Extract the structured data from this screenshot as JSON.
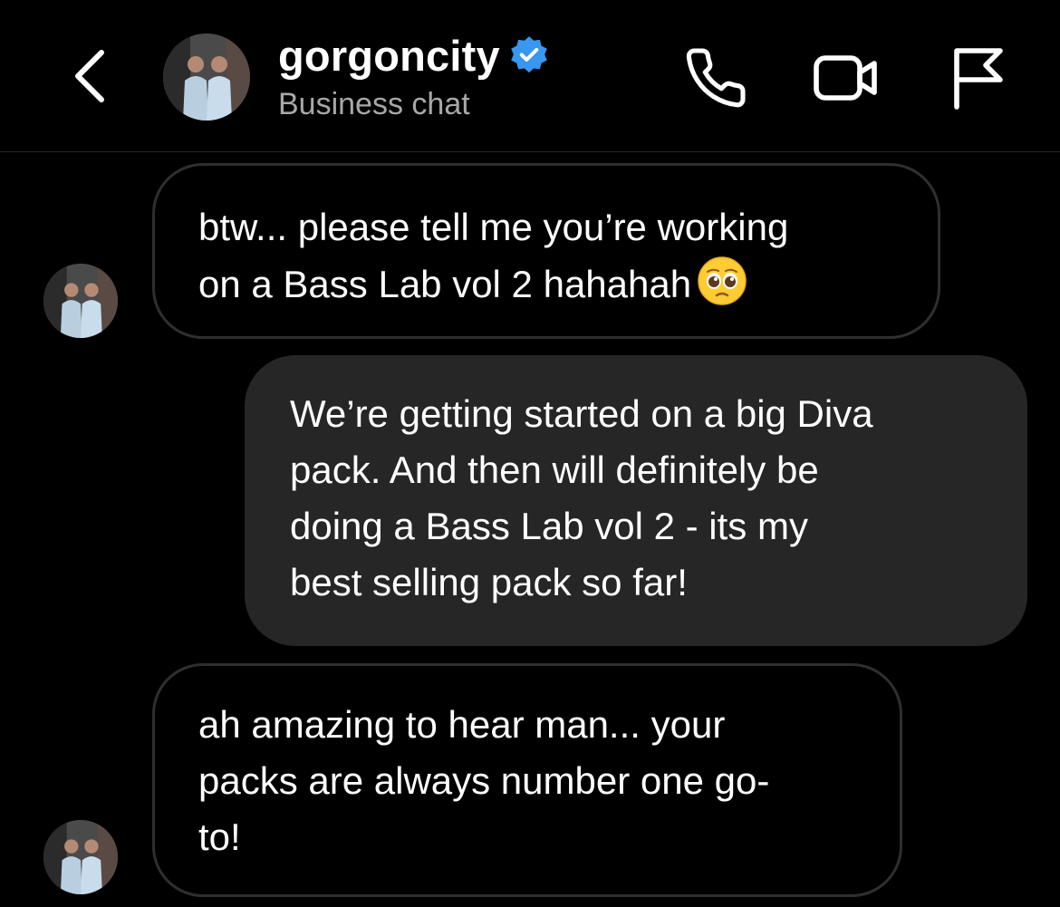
{
  "header": {
    "back_icon": "chevron-left-icon",
    "username": "gorgoncity",
    "verified_icon": "verified-badge-icon",
    "subtitle": "Business chat",
    "actions": [
      "phone-icon",
      "video-camera-icon",
      "flag-icon"
    ]
  },
  "messages": [
    {
      "direction": "incoming",
      "lines": [
        "btw... please tell me you’re working",
        "on a Bass Lab vol 2 hahahah"
      ],
      "emoji": "pleading-face-emoji"
    },
    {
      "direction": "outgoing",
      "lines": [
        "We’re getting started on a big Diva",
        "pack. And then will definitely be",
        "doing a Bass Lab vol 2 - its my",
        "best selling pack so far!"
      ]
    },
    {
      "direction": "incoming",
      "lines": [
        "ah amazing to hear man... your",
        "packs are always number one go-",
        "to!"
      ]
    }
  ],
  "colors": {
    "background": "#000000",
    "outgoing_bubble": "#262626",
    "incoming_border": "#2f2f2f",
    "verified": "#3897f0",
    "subtitle": "#a8a8a8"
  }
}
